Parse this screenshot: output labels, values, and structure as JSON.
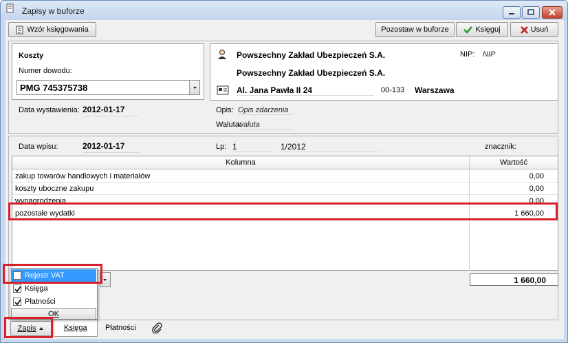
{
  "window": {
    "title": "Zapisy w buforze"
  },
  "toolbar": {
    "wzor_label": "Wzór księgowania",
    "pozostaw_label": "Pozostaw w buforze",
    "ksieguj_label": "Księguj",
    "usun_label": "Usuń"
  },
  "doc": {
    "section_title": "Koszty",
    "number_label": "Numer dowodu:",
    "number_value": "PMG 745375738",
    "issue_date_label": "Data wystawienia:",
    "issue_date_value": "2012-01-17"
  },
  "contractor": {
    "name1": "Powszechny Zakład Ubezpieczeń S.A.",
    "name2": "Powszechny Zakład Ubezpieczeń S.A.",
    "nip_label": "NIP:",
    "nip_value": "NIP",
    "street": "Al. Jana Pawła II 24",
    "postcode": "00-133",
    "city": "Warszawa",
    "opis_label": "Opis:",
    "opis_value": "Opis zdarzenia",
    "waluta_label": "Waluta:",
    "waluta_value": "waluta"
  },
  "entry": {
    "date_label": "Data wpisu:",
    "date_value": "2012-01-17",
    "lp_label": "Lp:",
    "lp_value": "1",
    "lp_number": "1/2012",
    "znacznik_label": "znacznik:"
  },
  "grid": {
    "col1": "Kolumna",
    "col2": "Wartość",
    "rows": [
      {
        "name": "zakup towarów handlowych i materiałów",
        "value": "0,00"
      },
      {
        "name": "koszty uboczne zakupu",
        "value": "0,00"
      },
      {
        "name": "wynagrodzenia",
        "value": "0,00"
      },
      {
        "name": "pozostałe wydatki",
        "value": "1 660,00"
      }
    ],
    "total": "1 660,00"
  },
  "popup": {
    "items": [
      {
        "label": "Rejestr VAT",
        "checked": false,
        "selected": true
      },
      {
        "label": "Księga",
        "checked": true
      },
      {
        "label": "Płatności",
        "checked": true
      }
    ],
    "ok_label": "OK"
  },
  "bottom": {
    "zapis_label": "Zapis",
    "tab_ksiega": "Księga",
    "tab_platnosci": "Płatności"
  },
  "colors": {
    "highlight": "#d8202a",
    "selection": "#3399ff",
    "ksieguj_check": "#2a9a2a",
    "usun_x": "#c01818"
  }
}
